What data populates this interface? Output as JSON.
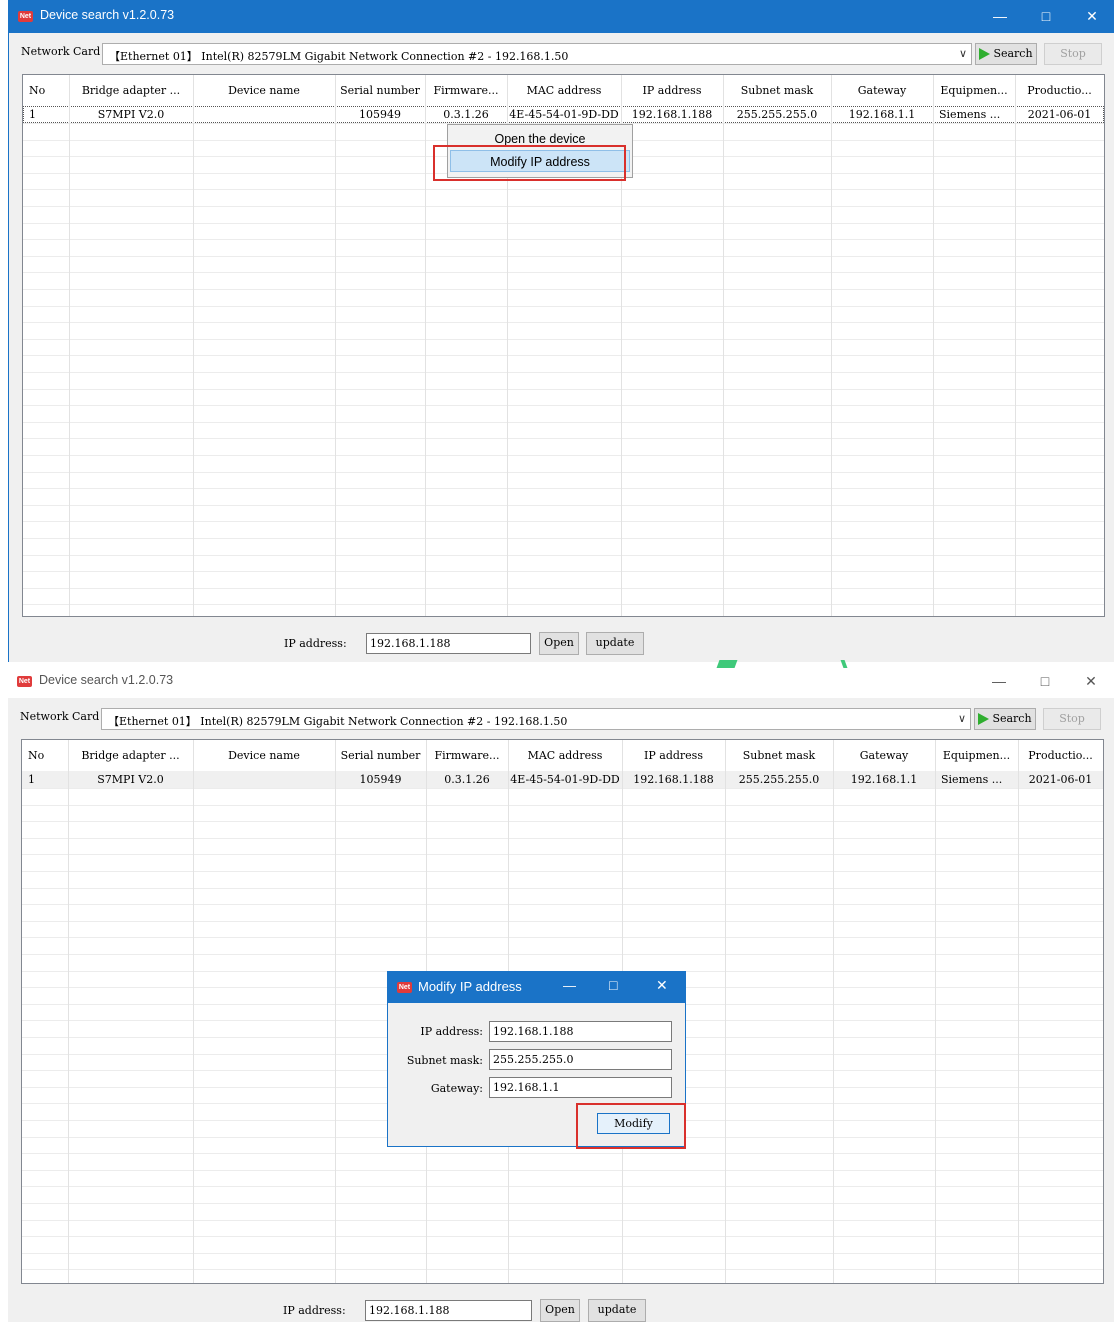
{
  "app": {
    "title": "Device search v1.2.0.73",
    "logo_text": "Net"
  },
  "toolbar": {
    "network_card_label": "Network Card",
    "network_card_value": "【Ethernet 01】 Intel(R) 82579LM Gigabit Network Connection #2 - 192.168.1.50",
    "search_label": "Search",
    "stop_label": "Stop"
  },
  "table": {
    "headers": [
      "No",
      "Bridge adapter ...",
      "Device name",
      "Serial number",
      "Firmware...",
      "MAC address",
      "IP address",
      "Subnet mask",
      "Gateway",
      "Equipmen...",
      "Productio..."
    ],
    "rows": [
      [
        "1",
        "S7MPI V2.0",
        "",
        "105949",
        "0.3.1.26",
        "4E-45-54-01-9D-DD",
        "192.168.1.188",
        "255.255.255.0",
        "192.168.1.1",
        "Siemens ...",
        "2021-06-01"
      ]
    ]
  },
  "context_menu": {
    "items": [
      "Open the device",
      "Modify IP address"
    ],
    "highlighted": "Modify IP address"
  },
  "bottom": {
    "ip_label": "IP address:",
    "ip_value": "192.168.1.188",
    "open_label": "Open",
    "update_label": "update"
  },
  "dialog": {
    "title": "Modify IP address",
    "ip_label": "IP  address:",
    "ip_value": "192.168.1.188",
    "mask_label": "Subnet mask:",
    "mask_value": "255.255.255.0",
    "gateway_label": "Gateway:",
    "gateway_value": "192.168.1.1",
    "modify_label": "Modify"
  },
  "colors": {
    "accent": "#1a73c7",
    "highlight_box": "#d9302c",
    "play": "#2fae2f"
  }
}
